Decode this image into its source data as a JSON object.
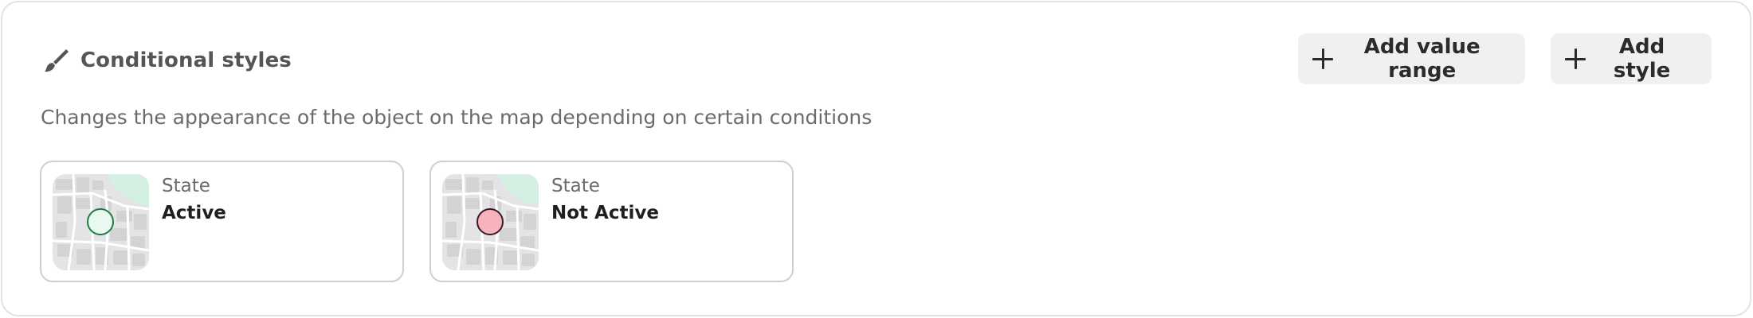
{
  "panel": {
    "title": "Conditional styles",
    "icon": "paint-brush-icon",
    "description": "Changes the appearance of the object on the map depending on certain conditions"
  },
  "actions": {
    "add_value_range": "Add value range",
    "add_style": "Add style"
  },
  "conditions": [
    {
      "label": "State",
      "value": "Active",
      "marker_fill": "#e9f8f0",
      "marker_stroke": "#1e7a45"
    },
    {
      "label": "State",
      "value": "Not Active",
      "marker_fill": "#f7b3bc",
      "marker_stroke": "#3a1a22"
    }
  ],
  "colors": {
    "button_bg": "#eff0f2",
    "border": "#cfcfd2",
    "map_park": "#d4f0e2"
  }
}
